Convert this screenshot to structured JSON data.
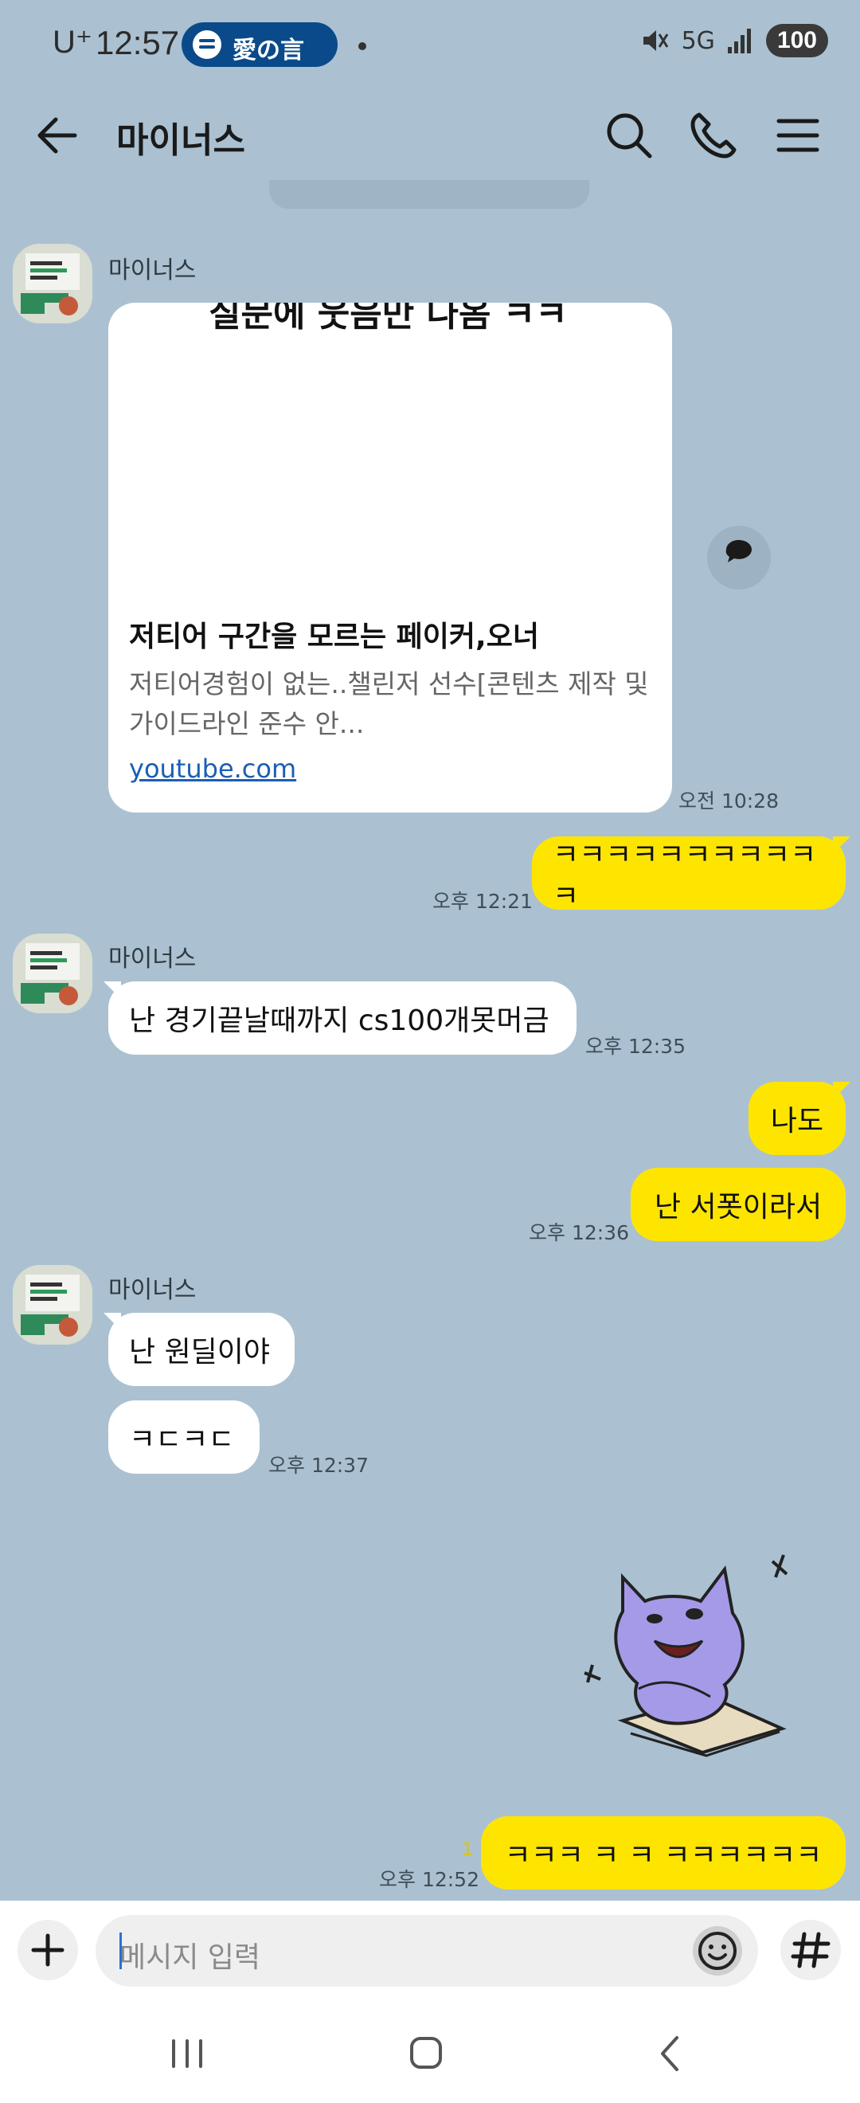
{
  "status_bar": {
    "carrier": "U⁺",
    "time": "12:57",
    "now_playing": "愛の言",
    "network": "5G",
    "battery": "100"
  },
  "header": {
    "title": "마이너스"
  },
  "messages": {
    "link_card": {
      "sender": "마이너스",
      "cut_text": "질문에 웃음만 나옴 ㅋㅋ",
      "title": "저티어 구간을 모르는 페이커,오너",
      "description": "저티어경험이 없는..챌린저 선수[콘텐츠 제작 및 가이드라인 준수 안...",
      "link": "youtube.com",
      "time": "오전 10:28"
    },
    "m1": {
      "text": "ㅋㅋㅋㅋㅋㅋㅋㅋㅋㅋㅋ",
      "time": "오후 12:21"
    },
    "m2": {
      "sender": "마이너스",
      "text": "난 경기끝날때까지 cs100개못머금",
      "time": "오후 12:35"
    },
    "m3": {
      "text": "나도"
    },
    "m4": {
      "text": "난 서폿이라서",
      "time": "오후 12:36"
    },
    "m5": {
      "sender": "마이너스",
      "text": "난 원딜이야"
    },
    "m6": {
      "text": "ㅋㄷㅋㄷ",
      "time": "오후 12:37"
    },
    "m7": {
      "text": "ㅋㅋㅋ ㅋ ㅋ ㅋㅋㅋㅋㅋㅋ",
      "time": "오후 12:52",
      "unread": "1"
    }
  },
  "input": {
    "placeholder": "메시지 입력"
  },
  "colors": {
    "chat_bg": "#abc1d1",
    "my_bubble": "#fee500",
    "their_bubble": "#ffffff",
    "link": "#1a5fb4"
  },
  "icons": [
    "back-arrow-icon",
    "search-icon",
    "phone-icon",
    "menu-icon",
    "share-icon",
    "plus-icon",
    "emoji-icon",
    "hash-icon",
    "recents-icon",
    "home-icon",
    "nav-back-icon",
    "mute-icon",
    "signal-icon",
    "spotify-icon"
  ]
}
